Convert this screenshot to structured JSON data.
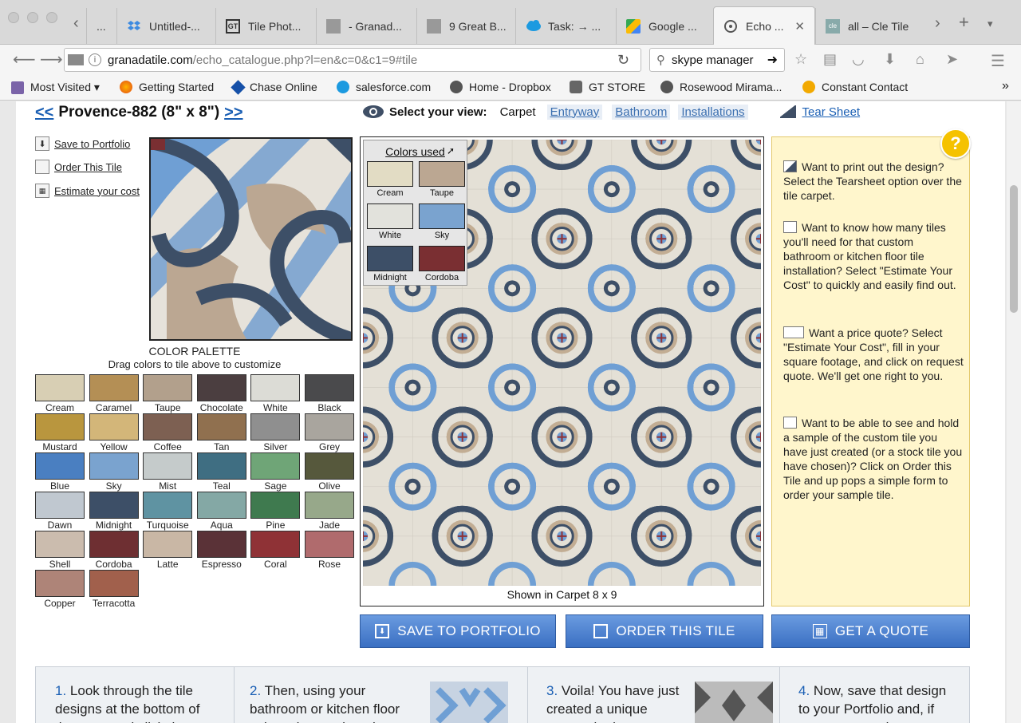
{
  "browser": {
    "tabs": [
      {
        "label": "...",
        "icon": "page-icon"
      },
      {
        "label": "Untitled-...",
        "icon": "dropbox-icon"
      },
      {
        "label": "Tile Phot...",
        "icon": "gt-icon"
      },
      {
        "label": "- Granad...",
        "icon": "granada-icon"
      },
      {
        "label": "9 Great B...",
        "icon": "granada-icon"
      },
      {
        "label": "Task: → ...",
        "icon": "salesforce-icon"
      },
      {
        "label": "Google ...",
        "icon": "maps-icon"
      },
      {
        "label": "Echo ...",
        "icon": "echo-icon",
        "active": true
      },
      {
        "label": "all – Cle Tile",
        "icon": "cle-icon"
      }
    ],
    "url_host": "granadatile.com",
    "url_path": "/echo_catalogue.php?l=en&c=0&c1=9#tile",
    "search_value": "skype manager",
    "bookmarks": [
      {
        "label": "Most Visited ▾"
      },
      {
        "label": "Getting Started"
      },
      {
        "label": "Chase Online"
      },
      {
        "label": "salesforce.com"
      },
      {
        "label": "Home - Dropbox"
      },
      {
        "label": "GT STORE"
      },
      {
        "label": "Rosewood Mirama..."
      },
      {
        "label": "Constant Contact"
      }
    ]
  },
  "tile": {
    "prev": "<<",
    "name": "Provence-882 (8\" x 8\")",
    "next": ">>"
  },
  "view": {
    "label": "Select your view:",
    "current": "Carpet",
    "options": [
      "Entryway",
      "Bathroom",
      "Installations"
    ],
    "tearsheet": "Tear Sheet"
  },
  "actions": {
    "save": "Save to Portfolio",
    "order": "Order This Tile",
    "estimate": "Estimate your cost"
  },
  "palette": {
    "title": "COLOR PALETTE",
    "subtitle": "Drag colors to tile above to customize",
    "colors": [
      {
        "name": "Cream",
        "hex": "#d8cfb4"
      },
      {
        "name": "Caramel",
        "hex": "#b48f55"
      },
      {
        "name": "Taupe",
        "hex": "#b2a08c"
      },
      {
        "name": "Chocolate",
        "hex": "#4b3e40"
      },
      {
        "name": "White",
        "hex": "#dcdcd6"
      },
      {
        "name": "Black",
        "hex": "#4a4a4c"
      },
      {
        "name": "Mustard",
        "hex": "#b9963e"
      },
      {
        "name": "Yellow",
        "hex": "#d3b679"
      },
      {
        "name": "Coffee",
        "hex": "#7d6052"
      },
      {
        "name": "Tan",
        "hex": "#90704f"
      },
      {
        "name": "Silver",
        "hex": "#8f8f8f"
      },
      {
        "name": "Grey",
        "hex": "#a9a59e"
      },
      {
        "name": "Blue",
        "hex": "#4a7fc1"
      },
      {
        "name": "Sky",
        "hex": "#7aa3cf"
      },
      {
        "name": "Mist",
        "hex": "#c5cbcb"
      },
      {
        "name": "Teal",
        "hex": "#3f6e82"
      },
      {
        "name": "Sage",
        "hex": "#6fa577"
      },
      {
        "name": "Olive",
        "hex": "#56583c"
      },
      {
        "name": "Dawn",
        "hex": "#c0c8d0"
      },
      {
        "name": "Midnight",
        "hex": "#3d4f67"
      },
      {
        "name": "Turquoise",
        "hex": "#5f93a2"
      },
      {
        "name": "Aqua",
        "hex": "#84a8a5"
      },
      {
        "name": "Pine",
        "hex": "#3f7a4f"
      },
      {
        "name": "Jade",
        "hex": "#97a88a"
      },
      {
        "name": "Shell",
        "hex": "#cbbcae"
      },
      {
        "name": "Cordoba",
        "hex": "#6e2f32"
      },
      {
        "name": "Latte",
        "hex": "#c9b7a5"
      },
      {
        "name": "Espresso",
        "hex": "#5a3237"
      },
      {
        "name": "Coral",
        "hex": "#8f3236"
      },
      {
        "name": "Rose",
        "hex": "#b06b6d"
      },
      {
        "name": "Copper",
        "hex": "#ae8478"
      },
      {
        "name": "Terracotta",
        "hex": "#a1604c"
      }
    ]
  },
  "colors_used": {
    "title": "Colors used",
    "colors": [
      {
        "name": "Cream",
        "hex": "#e2dcc4"
      },
      {
        "name": "Taupe",
        "hex": "#bba792"
      },
      {
        "name": "White",
        "hex": "#e2e2dc"
      },
      {
        "name": "Sky",
        "hex": "#7aa3cf"
      },
      {
        "name": "Midnight",
        "hex": "#3d4f67"
      },
      {
        "name": "Cordoba",
        "hex": "#7a2f32"
      }
    ]
  },
  "carpet": {
    "caption": "Shown in Carpet 8 x 9",
    "cols": 8,
    "rows": 9
  },
  "help": {
    "badge": "?",
    "items": [
      "Want to print out the design? Select the Tearsheet option over the tile carpet.",
      "Want to know how many tiles you'll need for that custom bathroom or kitchen floor tile installation? Select \"Estimate Your Cost\" to quickly and easily find out.",
      "Want a price quote? Select \"Estimate Your Cost\", fill in your square footage, and click on request quote. We'll get one right to you.",
      "Want to be able to see and hold a sample of the custom tile you have just created (or a stock tile you have chosen)? Click on Order this Tile and up pops a simple form to order your sample tile."
    ]
  },
  "buttons": {
    "save": "SAVE TO PORTFOLIO",
    "order": "ORDER THIS TILE",
    "quote": "GET A QUOTE"
  },
  "steps": [
    {
      "num": "1.",
      "text": "Look through the tile designs at the bottom of the page and click the"
    },
    {
      "num": "2.",
      "text": "Then, using your bathroom or kitchen floor color scheme, drag the"
    },
    {
      "num": "3.",
      "text": "Voila! You have just created a unique custom bathroom or"
    },
    {
      "num": "4.",
      "text": "Now, save that design to your Portfolio and, if you want, continue to"
    }
  ]
}
